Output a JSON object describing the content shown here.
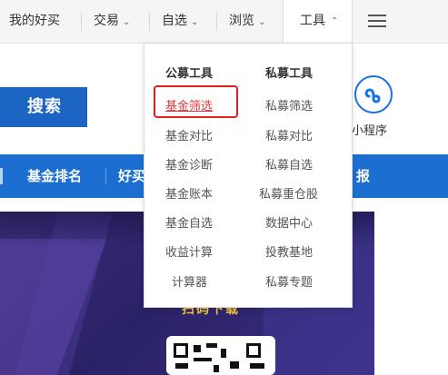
{
  "topnav": {
    "my_favorites": "我的好买",
    "trade": "交易",
    "watchlist": "自选",
    "browse": "浏览",
    "tools": "工具",
    "caret_down": "⌄",
    "caret_up": "^"
  },
  "search": {
    "button_label": "搜索"
  },
  "mini_program": {
    "label": "小程序",
    "icon": "mini-program-icon"
  },
  "subnav": {
    "items": [
      "基金排名",
      "好买",
      "报"
    ]
  },
  "banner": {
    "text": "扫码下载"
  },
  "dropdown": {
    "public_title": "公募工具",
    "private_title": "私募工具",
    "public_items": [
      "基金筛选",
      "基金对比",
      "基金诊断",
      "基金账本",
      "基金自选",
      "收益计算",
      "计算器"
    ],
    "private_items": [
      "私募筛选",
      "私募对比",
      "私募自选",
      "私募重仓股",
      "数据中心",
      "投教基地",
      "私募专题"
    ]
  },
  "colors": {
    "accent_blue": "#1c6fd1",
    "active_red": "#e4393c",
    "banner_gold": "#f0c43b"
  }
}
